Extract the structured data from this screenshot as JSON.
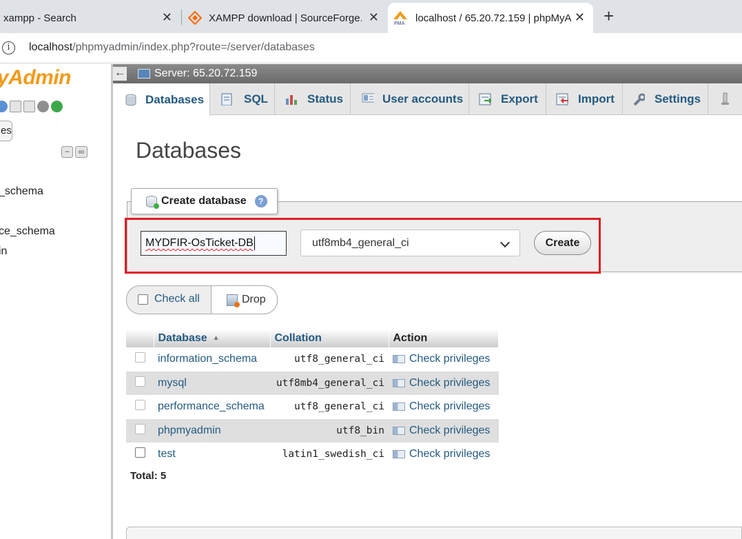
{
  "browser": {
    "tabs": [
      {
        "title": "xampp - Search",
        "close": "✕"
      },
      {
        "title": "XAMPP download | SourceForge.n",
        "close": "✕"
      },
      {
        "title": "localhost / 65.20.72.159 | phpMyA",
        "close": "✕"
      }
    ],
    "new_tab": "+",
    "url_host": "localhost",
    "url_path": "/phpmyadmin/index.php?route=/server/databases",
    "info_icon": "i"
  },
  "navigation": {
    "logo": "yAdmin",
    "tab_label": "es",
    "databases": [
      "_schema",
      "ce_schema",
      "in"
    ],
    "collapse_icon": "−",
    "link_icon": "∞"
  },
  "server_bar": {
    "back": "←",
    "label": "Server: 65.20.72.159"
  },
  "menu_tabs": [
    {
      "label": "Databases",
      "icon": "database-icon"
    },
    {
      "label": "SQL",
      "icon": "sql-icon"
    },
    {
      "label": "Status",
      "icon": "status-icon"
    },
    {
      "label": "User accounts",
      "icon": "user-accounts-icon"
    },
    {
      "label": "Export",
      "icon": "export-icon"
    },
    {
      "label": "Import",
      "icon": "import-icon"
    },
    {
      "label": "Settings",
      "icon": "settings-icon"
    }
  ],
  "page_title": "Databases",
  "create_database": {
    "legend": "Create database",
    "help_icon": "?",
    "name_value": "MYDFIR-OsTicket-DB",
    "collation_value": "utf8mb4_general_ci",
    "create_label": "Create"
  },
  "bulk_actions": {
    "check_all": "Check all",
    "drop": "Drop"
  },
  "table": {
    "headers": {
      "database": "Database",
      "collation": "Collation",
      "action": "Action",
      "sort_indicator": "▲"
    },
    "rows": [
      {
        "name": "information_schema",
        "collation": "utf8_general_ci",
        "action": "Check privileges"
      },
      {
        "name": "mysql",
        "collation": "utf8mb4_general_ci",
        "action": "Check privileges"
      },
      {
        "name": "performance_schema",
        "collation": "utf8_general_ci",
        "action": "Check privileges"
      },
      {
        "name": "phpmyadmin",
        "collation": "utf8_bin",
        "action": "Check privileges"
      },
      {
        "name": "test",
        "collation": "latin1_swedish_ci",
        "action": "Check privileges"
      }
    ],
    "total": "Total: 5"
  },
  "colors": {
    "accent_link": "#235a81",
    "logo_orange": "#f29a17",
    "highlight_red": "#e21b23"
  }
}
